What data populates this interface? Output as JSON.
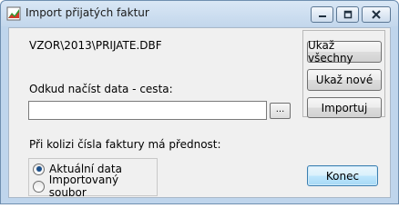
{
  "window": {
    "title": "Import přijatých faktur",
    "accent_color": "#bfd5ec"
  },
  "titlebar_buttons": {
    "minimize_icon": "minimize-icon",
    "maximize_icon": "maximize-icon",
    "close_icon": "close-icon"
  },
  "form": {
    "current_path": "VZOR\\2013\\PRIJATE.DBF",
    "source_label": "Odkud načíst data - cesta:",
    "source_value": "",
    "browse_label": "...",
    "conflict_label": "Při kolizi čísla faktury má přednost:",
    "radio_options": [
      {
        "label": "Aktuální data",
        "selected": true
      },
      {
        "label": "Importovaný soubor",
        "selected": false
      }
    ]
  },
  "buttons": {
    "show_all": "Ukaž všechny",
    "show_new": "Ukaž nové",
    "import": "Importuj",
    "end": "Konec"
  }
}
